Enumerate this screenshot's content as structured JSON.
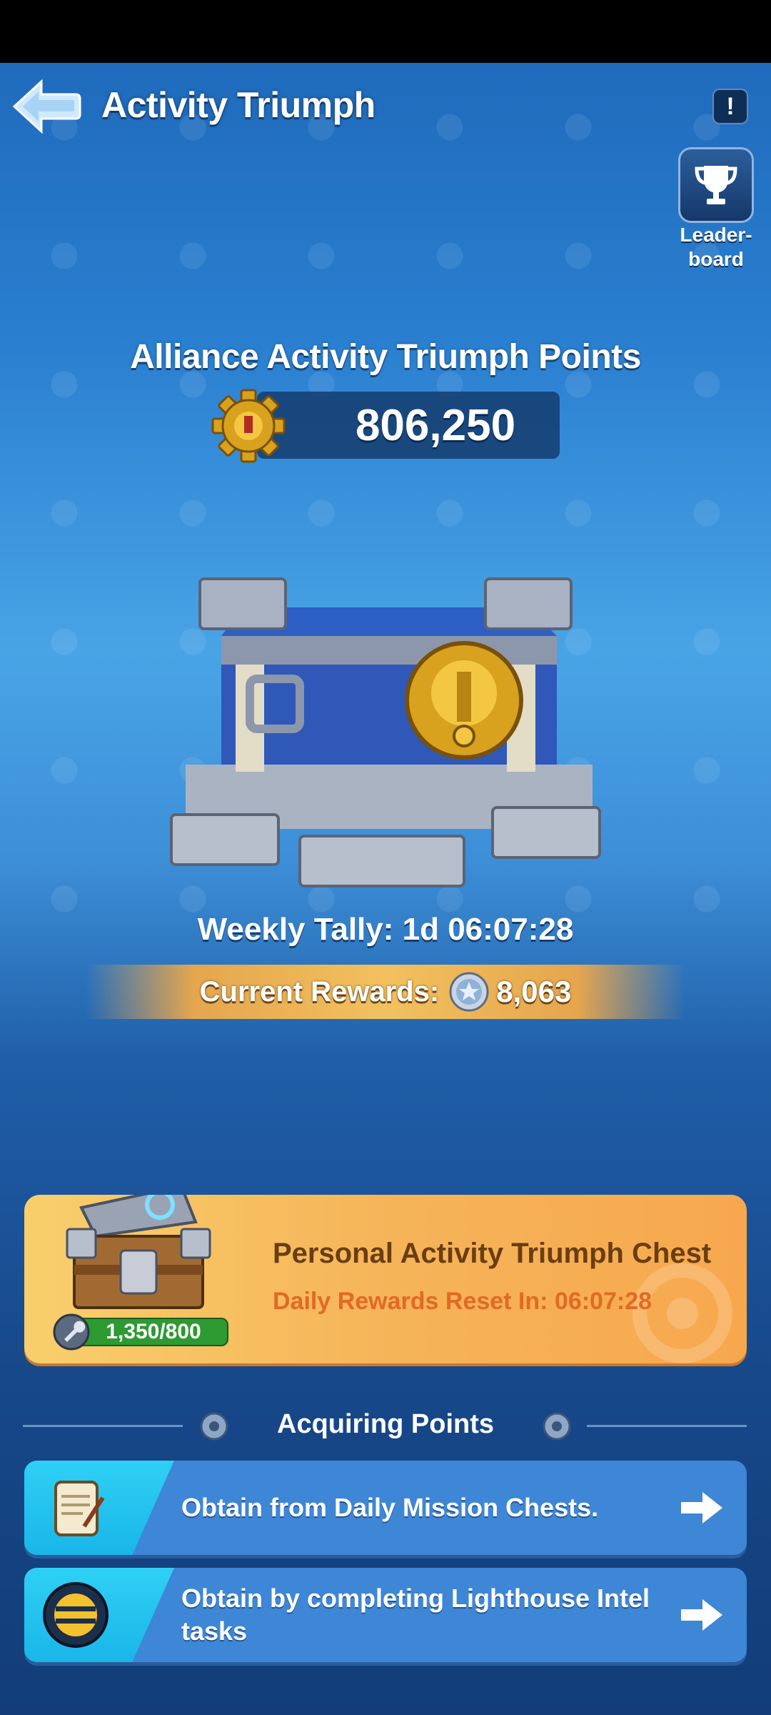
{
  "header": {
    "title": "Activity Triumph",
    "info_label": "!",
    "leaderboard_label_line1": "Leader-",
    "leaderboard_label_line2": "board"
  },
  "alliance": {
    "title": "Alliance Activity Triumph Points",
    "points": "806,250"
  },
  "tally": {
    "text": "Weekly Tally: 1d 06:07:28"
  },
  "rewards": {
    "label": "Current Rewards:",
    "value": "8,063"
  },
  "personal_chest": {
    "title": "Personal Activity Triumph Chest",
    "subtitle": "Daily Rewards Reset In: 06:07:28",
    "progress": "1,350/800"
  },
  "acquiring": {
    "title": "Acquiring Points",
    "tasks": [
      {
        "text": "Obtain from Daily Mission Chests.",
        "icon": "scroll-icon"
      },
      {
        "text": "Obtain by completing Lighthouse Intel tasks",
        "icon": "lighthouse-intel-icon"
      }
    ]
  },
  "colors": {
    "card_orange": "#f6b459",
    "task_blue": "#3e86d6",
    "task_cyan": "#2fd0f5",
    "progress_green": "#2e9a32"
  }
}
